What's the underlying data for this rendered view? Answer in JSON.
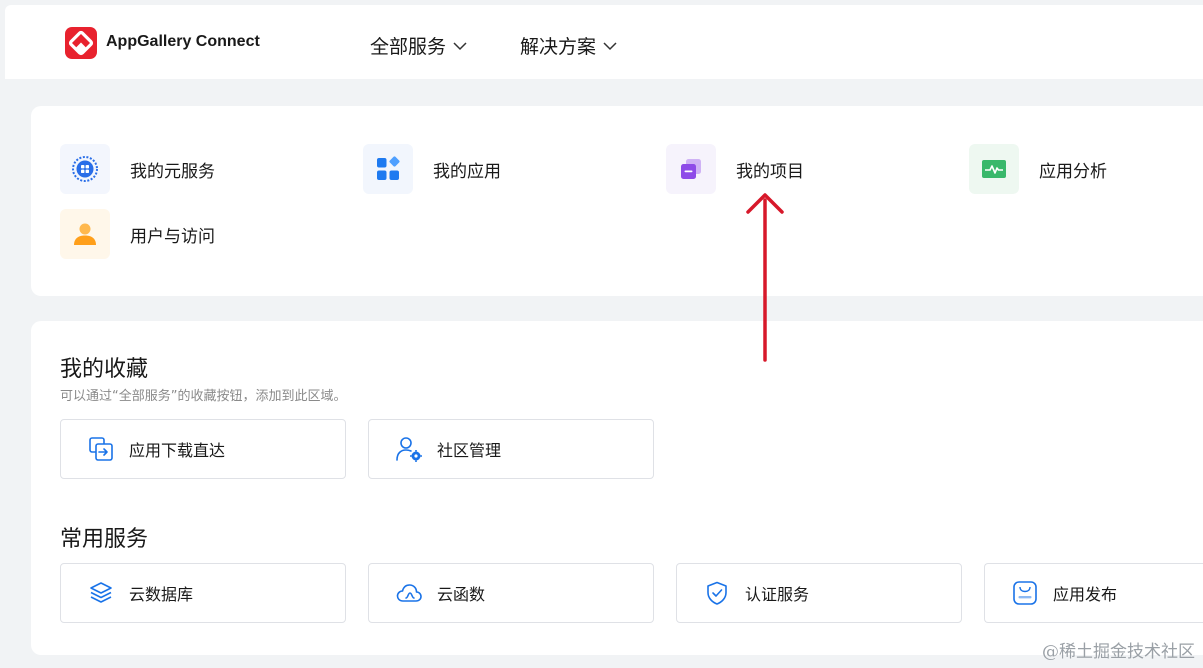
{
  "header": {
    "app_name": "AppGallery Connect",
    "nav": [
      {
        "label": "全部服务"
      },
      {
        "label": "解决方案"
      }
    ]
  },
  "shortcuts": [
    {
      "label": "我的元服务",
      "icon": "atomic-service-icon",
      "color": "#2a6ee8"
    },
    {
      "label": "我的应用",
      "icon": "apps-grid-icon",
      "color": "#1e7af0"
    },
    {
      "label": "我的项目",
      "icon": "project-stack-icon",
      "color": "#8e4be8"
    },
    {
      "label": "应用分析",
      "icon": "analytics-pulse-icon",
      "color": "#39b86b"
    },
    {
      "label": "用户与访问",
      "icon": "user-icon",
      "color": "#ff9f1a"
    }
  ],
  "favorites": {
    "title": "我的收藏",
    "subtitle": "可以通过“全部服务”的收藏按钮，添加到此区域。",
    "items": [
      {
        "label": "应用下载直达",
        "icon": "download-direct-icon"
      },
      {
        "label": "社区管理",
        "icon": "community-admin-icon"
      }
    ]
  },
  "common_services": {
    "title": "常用服务",
    "items": [
      {
        "label": "云数据库",
        "icon": "cloud-database-icon"
      },
      {
        "label": "云函数",
        "icon": "cloud-function-icon"
      },
      {
        "label": "认证服务",
        "icon": "auth-shield-icon"
      },
      {
        "label": "应用发布",
        "icon": "app-publish-icon"
      }
    ]
  },
  "watermark": "@稀土掘金技术社区",
  "colors": {
    "accent_blue": "#1a73e8",
    "arrow_red": "#d7182a",
    "brand_red": "#e8222e"
  }
}
